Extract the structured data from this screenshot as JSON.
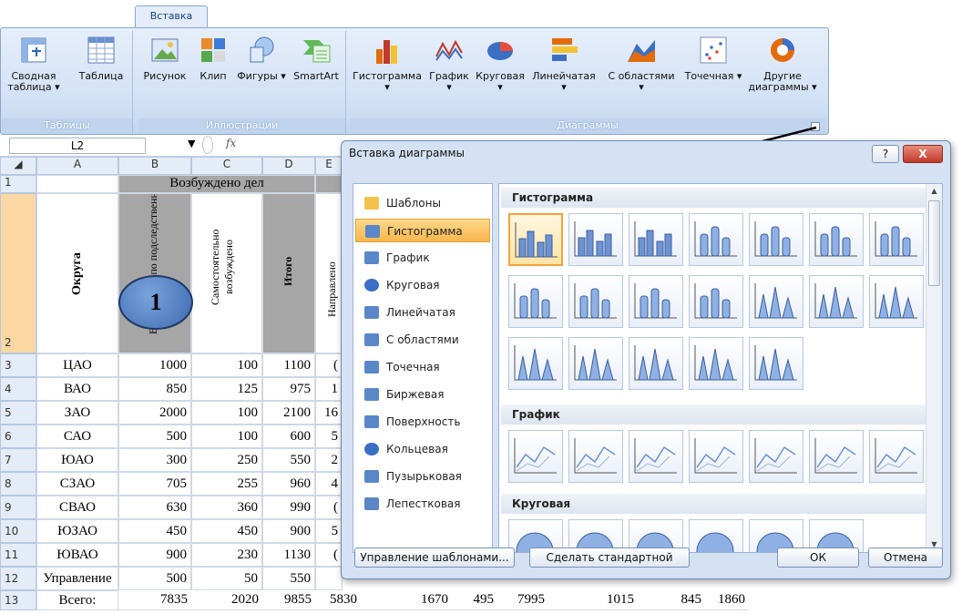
{
  "ribbon": {
    "tab": "Вставка",
    "groups": {
      "tables": "Таблицы",
      "illustrations": "Иллюстрации",
      "charts": "Диаграммы"
    },
    "buttons": {
      "pivot": "Сводная таблица ▾",
      "table": "Таблица",
      "picture": "Рисунок",
      "clip": "Клип",
      "shapes": "Фигуры ▾",
      "smartart": "SmartArt",
      "histogram": "Гистограмма ▾",
      "line": "График ▾",
      "pie": "Круговая ▾",
      "bar": "Линейчатая ▾",
      "area": "С областями ▾",
      "scatter": "Точечная ▾",
      "other": "Другие диаграммы ▾"
    }
  },
  "formula_bar": {
    "cell_ref": "L2",
    "fx": "fx"
  },
  "sheet": {
    "columns": [
      "A",
      "B",
      "C",
      "D",
      "E"
    ],
    "header_merged": "Возбуждено дел",
    "header_okruga": "Округа",
    "header_b": "Возбуждено по подследственности",
    "header_c": "Самостоятельно возбуждено",
    "header_d": "Итого",
    "header_e": "Направлено",
    "row_numbers": [
      "1",
      "2",
      "3",
      "4",
      "5",
      "6",
      "7",
      "8",
      "9",
      "10",
      "11",
      "12",
      "13"
    ],
    "rows": [
      {
        "a": "ЦАО",
        "b": "1000",
        "c": "100",
        "d": "1100",
        "e": "("
      },
      {
        "a": "ВАО",
        "b": "850",
        "c": "125",
        "d": "975",
        "e": "1"
      },
      {
        "a": "ЗАО",
        "b": "2000",
        "c": "100",
        "d": "2100",
        "e": "16"
      },
      {
        "a": "САО",
        "b": "500",
        "c": "100",
        "d": "600",
        "e": "5"
      },
      {
        "a": "ЮАО",
        "b": "300",
        "c": "250",
        "d": "550",
        "e": "2"
      },
      {
        "a": "СЗАО",
        "b": "705",
        "c": "255",
        "d": "960",
        "e": "4"
      },
      {
        "a": "СВАО",
        "b": "630",
        "c": "360",
        "d": "990",
        "e": "("
      },
      {
        "a": "ЮЗАО",
        "b": "450",
        "c": "450",
        "d": "900",
        "e": "5"
      },
      {
        "a": "ЮВАО",
        "b": "900",
        "c": "230",
        "d": "1130",
        "e": "("
      },
      {
        "a": "Управление",
        "b": "500",
        "c": "50",
        "d": "550",
        "e": ""
      }
    ],
    "total": {
      "label": "Всего:",
      "values": [
        "7835",
        "2020",
        "9855",
        "5830",
        "1670",
        "495",
        "7995",
        "1015",
        "845",
        "1860"
      ]
    },
    "badge": "1"
  },
  "dialog": {
    "title": "Вставка диаграммы",
    "help": "?",
    "close": "X",
    "categories": [
      "Шаблоны",
      "Гистограмма",
      "График",
      "Круговая",
      "Линейчатая",
      "С областями",
      "Точечная",
      "Биржевая",
      "Поверхность",
      "Кольцевая",
      "Пузырьковая",
      "Лепестковая"
    ],
    "selected_category": "Гистограмма",
    "sections": {
      "histogram": "Гистограмма",
      "line": "График",
      "pie": "Круговая"
    },
    "manage_templates": "Управление шаблонами...",
    "set_default": "Сделать стандартной",
    "ok": "ОК",
    "cancel": "Отмена"
  },
  "colors": {
    "accent_orange": "#f3a33c",
    "badge_fill": "#4f7dc0",
    "grey_cell": "#a6a6a6",
    "header_orange": "#fbd7a3"
  }
}
